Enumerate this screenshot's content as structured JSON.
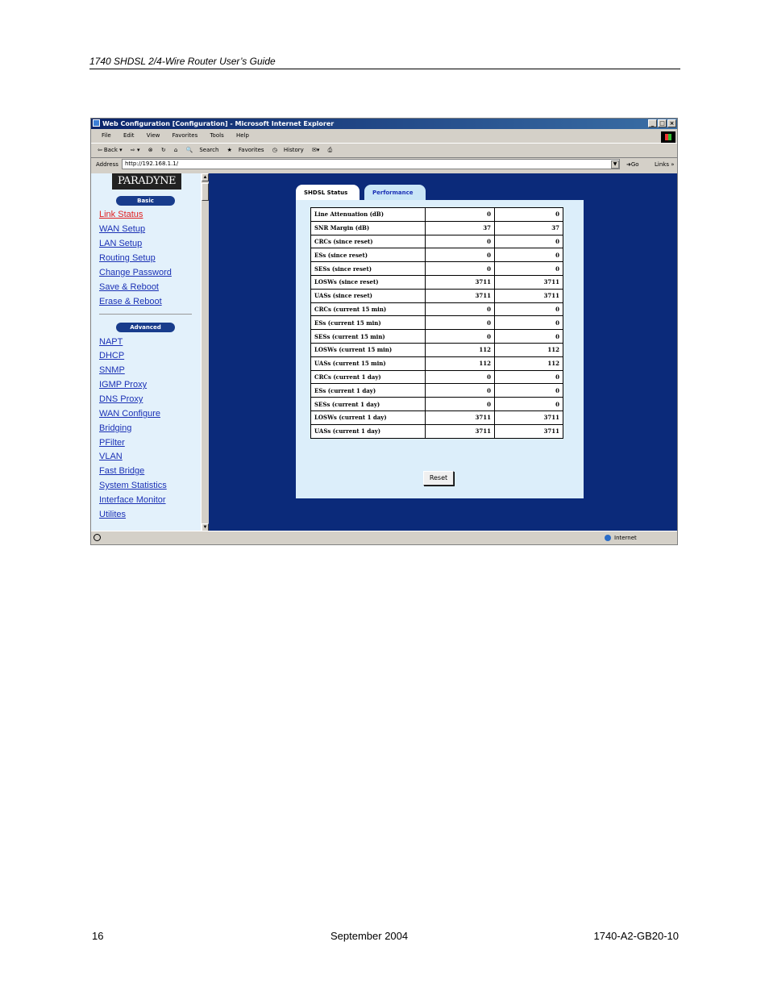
{
  "document": {
    "header": "1740 SHDSL 2/4-Wire Router User’s Guide",
    "footer": {
      "page": "16",
      "date": "September 2004",
      "doc_id": "1740-A2-GB20-10"
    }
  },
  "browser": {
    "title": "Web Configuration [Configuration] - Microsoft Internet Explorer",
    "menu": [
      "File",
      "Edit",
      "View",
      "Favorites",
      "Tools",
      "Help"
    ],
    "toolbar": {
      "back": "Back",
      "search": "Search",
      "favorites": "Favorites",
      "history": "History"
    },
    "address_label": "Address",
    "address": "http://192.168.1.1/",
    "go": "Go",
    "links": "Links",
    "status_zone": "Internet"
  },
  "nav": {
    "logo": "PARADYNE",
    "basic_label": "Basic",
    "basic_items": [
      "Link Status",
      "WAN Setup",
      "LAN Setup",
      "Routing Setup",
      "Change Password",
      "Save & Reboot",
      "Erase & Reboot"
    ],
    "advanced_label": "Advanced",
    "advanced_items": [
      "NAPT",
      "DHCP",
      "SNMP",
      "IGMP Proxy",
      "DNS Proxy",
      "WAN Configure",
      "Bridging",
      "PFilter",
      "VLAN",
      "Fast Bridge",
      "System Statistics",
      "Interface Monitor",
      "Utilites"
    ]
  },
  "tabs": {
    "shdsl_status": "SHDSL Status",
    "performance": "Performance"
  },
  "performance": {
    "rows": [
      [
        "Line Attenuation (dB)",
        "0",
        "0"
      ],
      [
        "SNR Margin (dB)",
        "37",
        "37"
      ],
      [
        "CRCs  (since reset)",
        "0",
        "0"
      ],
      [
        "ESs   (since reset)",
        "0",
        "0"
      ],
      [
        "SESs   (since reset)",
        "0",
        "0"
      ],
      [
        "LOSWs (since reset)",
        "3711",
        "3711"
      ],
      [
        "UASs  (since reset)",
        "3711",
        "3711"
      ],
      [
        "CRCs   (current 15 min)",
        "0",
        "0"
      ],
      [
        "ESs   (current 15 min)",
        "0",
        "0"
      ],
      [
        "SESs  (current 15 min)",
        "0",
        "0"
      ],
      [
        "LOSWs (current 15 min)",
        "112",
        "112"
      ],
      [
        "UASs  (current 15 min)",
        "112",
        "112"
      ],
      [
        "CRCs  (current 1 day)",
        "0",
        "0"
      ],
      [
        "ESs   (current 1 day)",
        "0",
        "0"
      ],
      [
        "SESs  (current 1 day)",
        "0",
        "0"
      ],
      [
        "LOSWs (current 1 day)",
        "3711",
        "3711"
      ],
      [
        "UASs  (current 1 day)",
        "3711",
        "3711"
      ]
    ],
    "reset_label": "Reset"
  }
}
